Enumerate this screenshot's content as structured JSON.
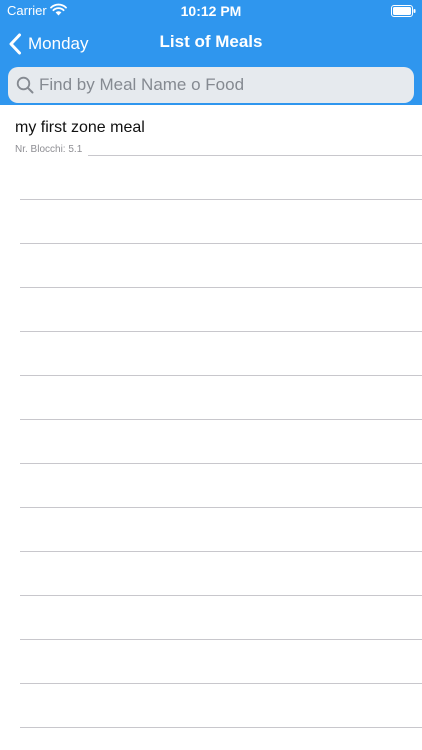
{
  "status_bar": {
    "carrier": "Carrier",
    "time": "10:12 PM"
  },
  "nav": {
    "back_label": "Monday",
    "title": "List of Meals"
  },
  "search": {
    "placeholder": "Find by Meal Name o Food",
    "value": ""
  },
  "meals": [
    {
      "name": "my first zone meal",
      "detail": "Nr. Blocchi: 5.1"
    }
  ],
  "colors": {
    "nav_background": "#2f96ee",
    "search_background": "#e6eaee",
    "separator": "#c8c7cc"
  },
  "icons": {
    "wifi": "wifi-icon",
    "battery": "battery-icon",
    "back": "chevron-left-icon",
    "search": "search-icon"
  }
}
